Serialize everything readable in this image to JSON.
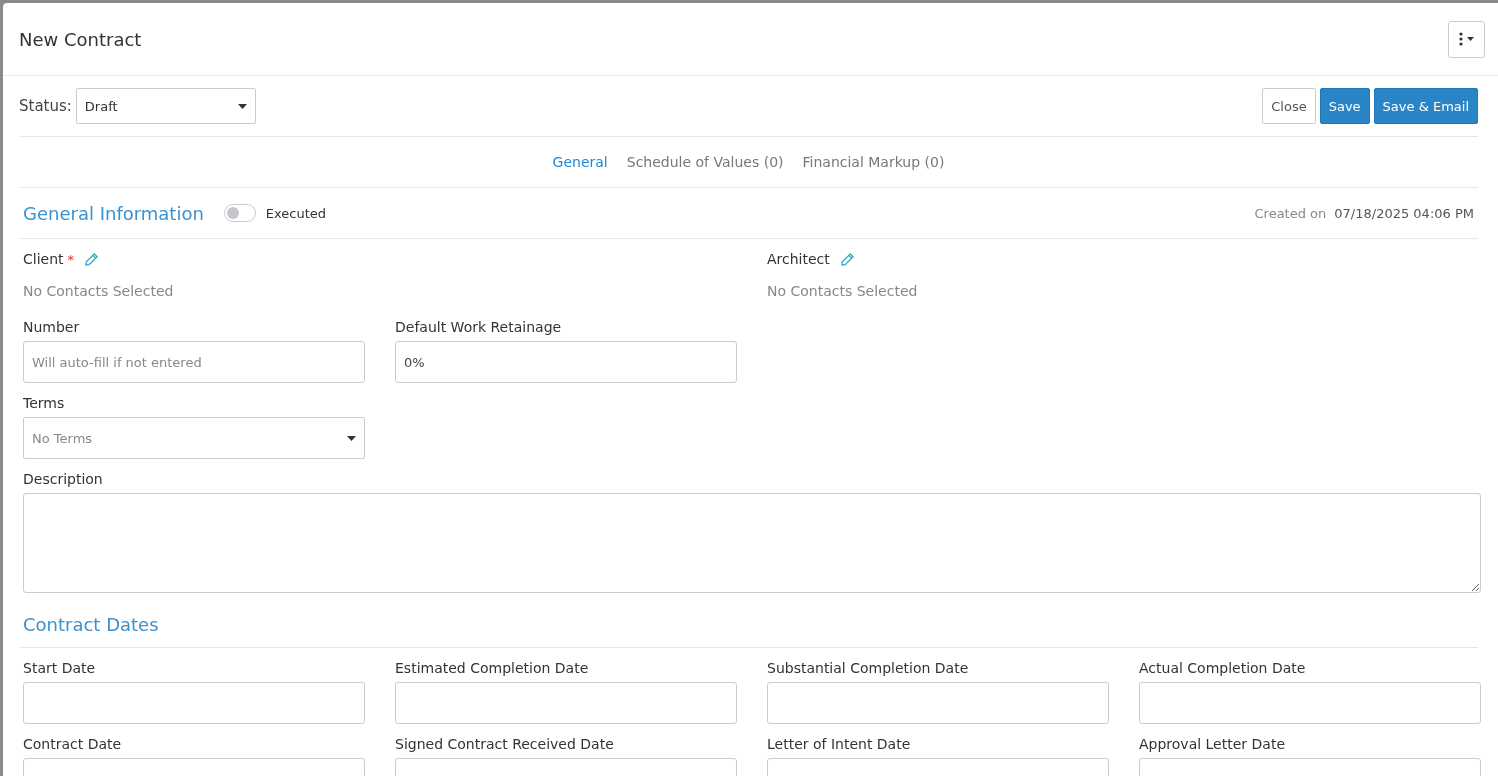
{
  "window": {
    "title": "New Contract"
  },
  "toolbar": {
    "status_label": "Status:",
    "status_value": "Draft",
    "buttons": [
      {
        "label": "Close",
        "kind": "default"
      },
      {
        "label": "Save",
        "kind": "primary"
      },
      {
        "label": "Save & Email",
        "kind": "primary"
      }
    ]
  },
  "tabs": [
    {
      "label": "General",
      "selected": true
    },
    {
      "label": "Schedule of Values (0)",
      "selected": false
    },
    {
      "label": "Financial Markup (0)",
      "selected": false
    }
  ],
  "general_information": {
    "title": "General Information",
    "executed": {
      "label": "Executed",
      "on": false
    },
    "created_label": "Created on",
    "created_value": "07/18/2025 04:06 PM",
    "contacts": [
      {
        "label": "Client",
        "required_mark": "*",
        "value": "No Contacts Selected"
      },
      {
        "label": "Architect",
        "value": "No Contacts Selected"
      }
    ],
    "fields": [
      {
        "label": "Number",
        "kind": "input",
        "placeholder": "Will auto-fill if not entered"
      },
      {
        "label": "Default Work Retainage",
        "kind": "input",
        "value": "0%"
      }
    ],
    "terms": {
      "label": "Terms",
      "kind": "select",
      "placeholder": "No Terms"
    },
    "description": {
      "label": "Description"
    }
  },
  "contract_dates": {
    "title": "Contract Dates",
    "fields": [
      {
        "label": "Start Date"
      },
      {
        "label": "Estimated Completion Date"
      },
      {
        "label": "Substantial Completion Date"
      },
      {
        "label": "Actual Completion Date"
      },
      {
        "label": "Contract Date"
      },
      {
        "label": "Signed Contract Received Date"
      },
      {
        "label": "Letter of Intent Date"
      },
      {
        "label": "Approval Letter Date"
      }
    ]
  }
}
